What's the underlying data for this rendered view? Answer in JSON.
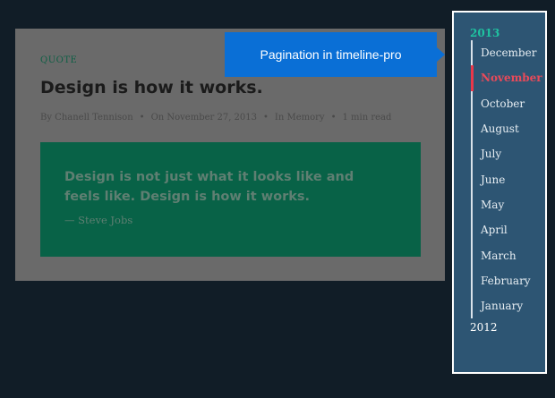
{
  "post": {
    "category": "QUOTE",
    "title": "Design is how it works.",
    "meta": {
      "author": "By Chanell Tennison",
      "date": "On November 27, 2013",
      "category": "In Memory",
      "read_time": "1 min read",
      "separator": "•"
    },
    "quote": {
      "text": "Design is not just what it looks like and feels like. Design is how it works.",
      "author": "—  Steve Jobs"
    }
  },
  "tooltip": {
    "text": "Pagination in timeline-pro"
  },
  "timeline": {
    "current_year": "2013",
    "previous_year": "2012",
    "active_month": "November",
    "months": [
      "December",
      "November",
      "October",
      "August",
      "July",
      "June",
      "May",
      "April",
      "March",
      "February",
      "January"
    ]
  },
  "colors": {
    "background": "#111d27",
    "card": "#6a6a6a",
    "quote_box": "#086247",
    "tooltip": "#0a6fd6",
    "timeline_panel": "#2d5573",
    "year_accent": "#1fc3a0",
    "active_month": "#e84a5a"
  }
}
